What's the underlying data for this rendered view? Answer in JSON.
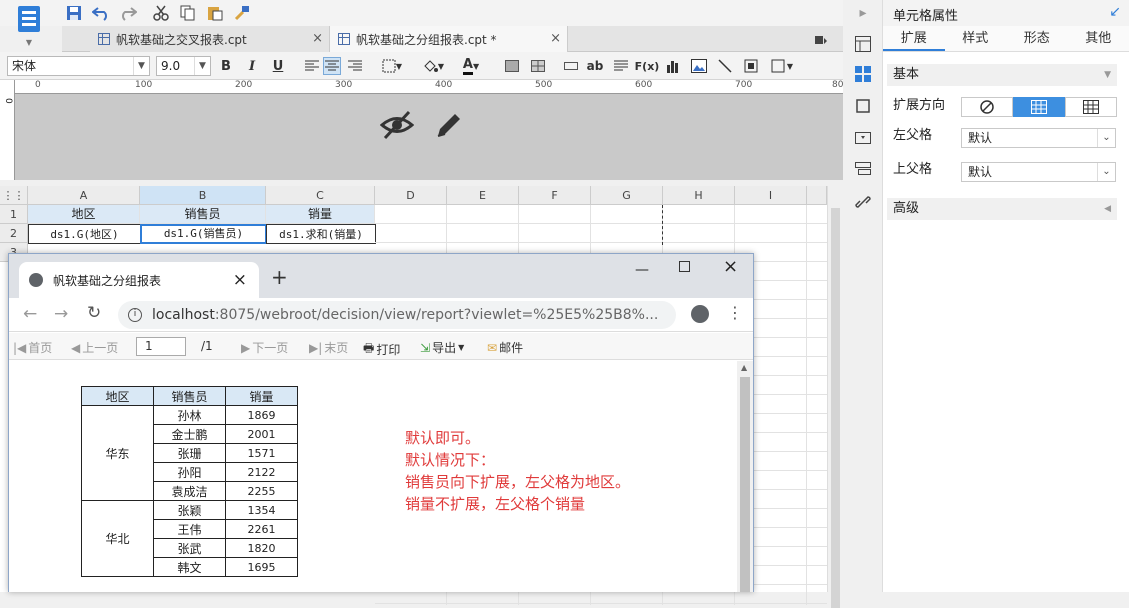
{
  "tabs": [
    {
      "label": "帆软基础之交叉报表.cpt",
      "close": "×"
    },
    {
      "label": "帆软基础之分组报表.cpt *",
      "close": "×"
    }
  ],
  "format": {
    "font_name": "宋体",
    "font_size": "9.0",
    "bold": "B",
    "italic": "I",
    "underline": "U",
    "fx": "F(x)",
    "ab": "ab"
  },
  "ruler": {
    "marks": [
      "0",
      "100",
      "200",
      "300",
      "400",
      "500",
      "600",
      "700",
      "80"
    ],
    "v_mark": "0"
  },
  "sheet": {
    "columns": [
      "A",
      "B",
      "C",
      "D",
      "E",
      "F",
      "G",
      "H",
      "I"
    ],
    "rows": [
      "1",
      "2",
      "3"
    ],
    "row1": [
      "地区",
      "销售员",
      "销量"
    ],
    "row2": [
      "ds1.G(地区)",
      "ds1.G(销售员)",
      "ds1.求和(销量)"
    ]
  },
  "panel": {
    "title": "单元格属性",
    "tabs": [
      "扩展",
      "样式",
      "形态",
      "其他"
    ],
    "basic": "基本",
    "expand_dir": "扩展方向",
    "left_parent": "左父格",
    "left_parent_value": "默认",
    "top_parent": "上父格",
    "top_parent_value": "默认",
    "advanced": "高级"
  },
  "browser": {
    "tab_title": "帆软基础之分组报表",
    "close": "×",
    "new_tab": "+",
    "url_host": "localhost",
    "url_rest": ":8075/webroot/decision/view/report?viewlet=%25E5%25B8%...",
    "toolbar": {
      "first": "首页",
      "prev": "上一页",
      "page": "1",
      "total": "/1",
      "next": "下一页",
      "last": "末页",
      "print": "打印",
      "export": "导出",
      "mail": "邮件"
    }
  },
  "report": {
    "headers": [
      "地区",
      "销售员",
      "销量"
    ],
    "groups": [
      {
        "region": "华东",
        "rows": [
          [
            "孙林",
            "1869"
          ],
          [
            "金士鹏",
            "2001"
          ],
          [
            "张珊",
            "1571"
          ],
          [
            "孙阳",
            "2122"
          ],
          [
            "袁成洁",
            "2255"
          ]
        ]
      },
      {
        "region": "华北",
        "rows": [
          [
            "张颖",
            "1354"
          ],
          [
            "王伟",
            "2261"
          ],
          [
            "张武",
            "1820"
          ],
          [
            "韩文",
            "1695"
          ]
        ]
      }
    ]
  },
  "notes": [
    "默认即可。",
    "默认情况下：",
    "销售员向下扩展，左父格为地区。",
    "销量不扩展，左父格个销量"
  ],
  "colors": {
    "accent": "#2f7ed8",
    "header_cell": "#dbe9f6",
    "note": "#e03b3b"
  }
}
